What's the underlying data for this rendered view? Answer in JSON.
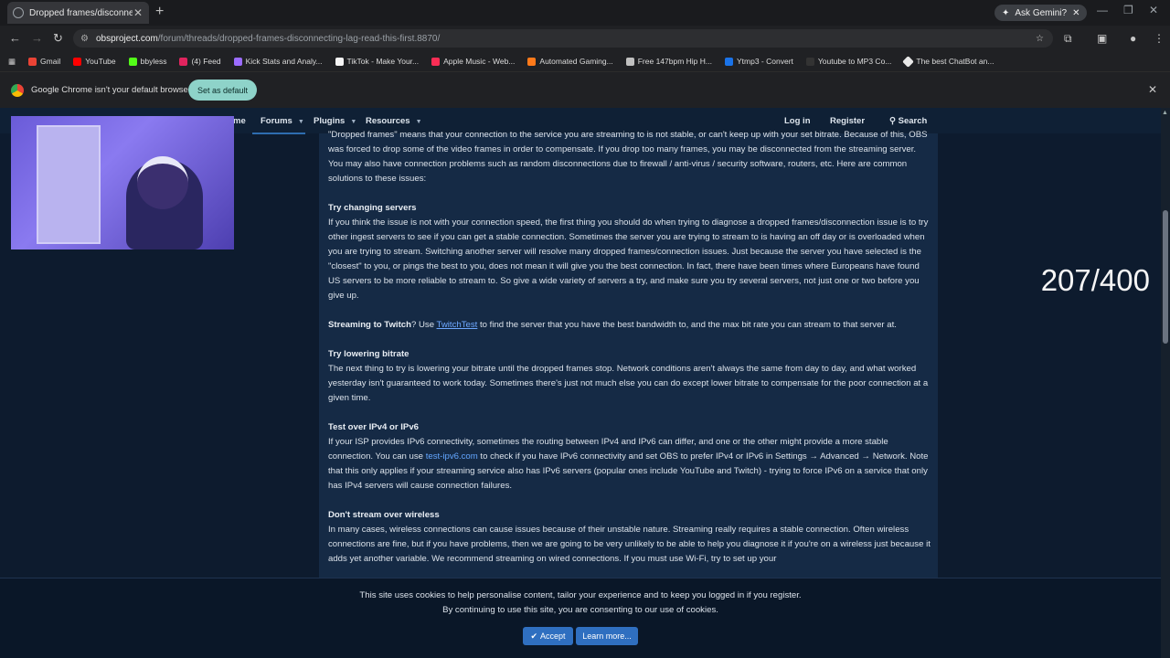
{
  "browser": {
    "tab_title": "Dropped frames/disconnecting",
    "new_tab_glyph": "+",
    "gemini_label": "Ask Gemini?",
    "url_host": "obsproject.com",
    "url_path": "/forum/threads/dropped-frames-disconnecting-lag-read-this-first.8870/",
    "bookmarks": [
      "Gmail",
      "YouTube",
      "bbyless",
      "(4) Feed",
      "Kick Stats and Analy...",
      "TikTok - Make Your...",
      "Apple Music - Web...",
      "Automated Gaming...",
      "Free 147bpm Hip H...",
      "Ytmp3 - Convert",
      "Youtube to MP3 Co...",
      "The best ChatBot an..."
    ],
    "infobar_message": "Google Chrome isn't your default browser",
    "infobar_button": "Set as default"
  },
  "sitenav": {
    "home_fragment": "me",
    "forums": "Forums",
    "plugins": "Plugins",
    "resources": "Resources",
    "login": "Log in",
    "register": "Register",
    "search": "Search"
  },
  "article": {
    "intro": "\"Dropped frames\" means that your connection to the service you are streaming to is not stable, or can't keep up with your set bitrate. Because of this, OBS was forced to drop some of the video frames in order to compensate. If you drop too many frames, you may be disconnected from the streaming server. You may also have connection problems such as random disconnections due to firewall / anti-virus / security software, routers, etc. Here are common solutions to these issues:",
    "s1_title": "Try changing servers",
    "s1_body": "If you think the issue is not with your connection speed, the first thing you should do when trying to diagnose a dropped frames/disconnection issue is to try other ingest servers to see if you can get a stable connection. Sometimes the server you are trying to stream to is having an off day or is overloaded when you are trying to stream. Switching another server will resolve many dropped frames/connection issues. Just because the server you have selected is the \"closest\" to you, or pings the best to you, does not mean it will give you the best connection. In fact, there have been times where Europeans have found US servers to be more reliable to stream to. So give a wide variety of servers a try, and make sure you try several servers, not just one or two before you give up.",
    "s2_title": "Streaming to Twitch",
    "s2_pre": "? Use ",
    "s2_link": "TwitchTest",
    "s2_post": " to find the server that you have the best bandwidth to, and the max bit rate you can stream to that server at.",
    "s3_title": "Try lowering bitrate",
    "s3_body": "The next thing to try is lowering your bitrate until the dropped frames stop. Network conditions aren't always the same from day to day, and what worked yesterday isn't guaranteed to work today. Sometimes there's just not much else you can do except lower bitrate to compensate for the poor connection at a given time.",
    "s4_title": "Test over IPv4 or IPv6",
    "s4_pre": "If your ISP provides IPv6 connectivity, sometimes the routing between IPv4 and IPv6 can differ, and one or the other might provide a more stable connection. You can use ",
    "s4_link": "test-ipv6.com",
    "s4_post": " to check if you have IPv6 connectivity and set OBS to prefer IPv4 or IPv6 in Settings → Advanced → Network. Note that this only applies if your streaming service also has IPv6 servers (popular ones include YouTube and Twitch) - trying to force IPv6 on a service that only has IPv4 servers will cause connection failures.",
    "s5_title": "Don't stream over wireless",
    "s5_body": "In many cases, wireless connections can cause issues because of their unstable nature. Streaming really requires a stable connection. Often wireless connections are fine, but if you have problems, then we are going to be very unlikely to be able to help you diagnose it if you're on a wireless just because it adds yet another variable. We recommend streaming on wired connections. If you must use Wi-Fi, try to set up your"
  },
  "overlay": {
    "counter": "207/400"
  },
  "cookie": {
    "line1": "This site uses cookies to help personalise content, tailor your experience and to keep you logged in if you register.",
    "line2": "By continuing to use this site, you are consenting to our use of cookies.",
    "accept": "Accept",
    "learn_more": "Learn more..."
  },
  "colors": {
    "page_bg": "#0d1b2e",
    "content_bg": "#152a45",
    "link": "#63a6ff",
    "button": "#2f6fc0",
    "infobar_button": "#8ed3c9"
  }
}
